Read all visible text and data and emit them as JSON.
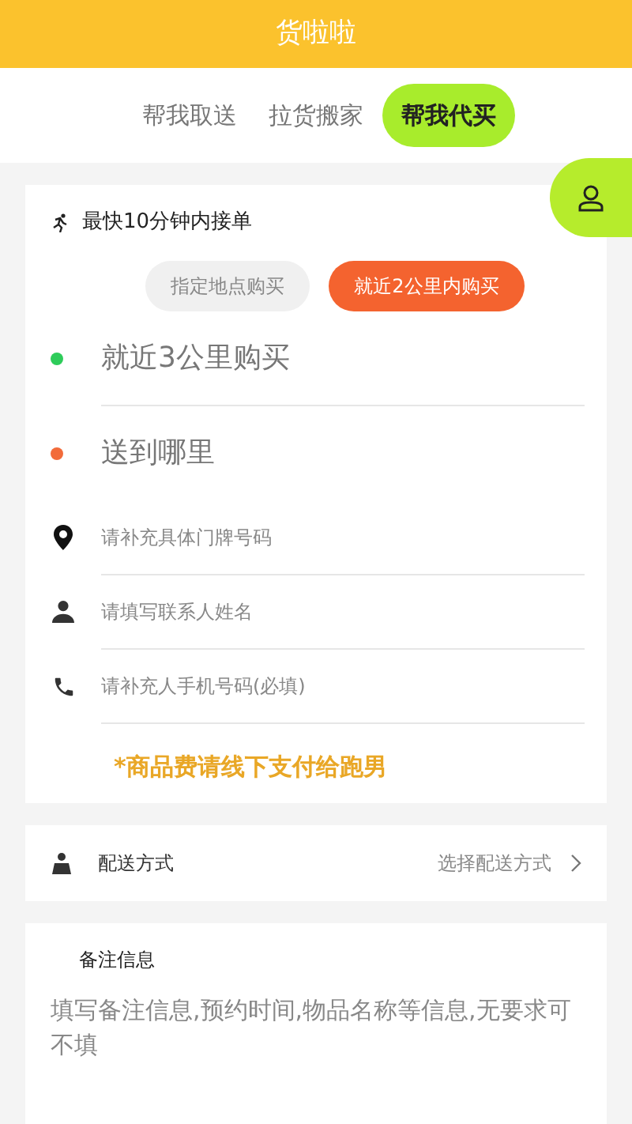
{
  "header": {
    "title": "货啦啦"
  },
  "tabs": [
    {
      "label": "帮我取送",
      "selected": false
    },
    {
      "label": "拉货搬家",
      "selected": false
    },
    {
      "label": "帮我代买",
      "selected": true
    }
  ],
  "order_card": {
    "speed_note": "最快10分钟内接单",
    "modes": [
      {
        "label": "指定地点购买",
        "selected": false
      },
      {
        "label": "就近2公里内购买",
        "selected": true
      }
    ],
    "stops": [
      {
        "label": "就近3公里购买",
        "color": "#2ecc5a"
      },
      {
        "label": "送到哪里",
        "color": "#f26b3a"
      }
    ],
    "fields": [
      {
        "kind": "location",
        "placeholder": "请补充具体门牌号码"
      },
      {
        "kind": "person",
        "placeholder": "请填写联系人姓名"
      },
      {
        "kind": "phone",
        "placeholder": "请补充人手机号码(必填)"
      }
    ],
    "notice": "*商品费请线下支付给跑男"
  },
  "delivery": {
    "label": "配送方式",
    "value": "选择配送方式"
  },
  "remarks": {
    "title": "备注信息",
    "placeholder": "填写备注信息,预约时间,物品名称等信息,无要求可不填"
  }
}
